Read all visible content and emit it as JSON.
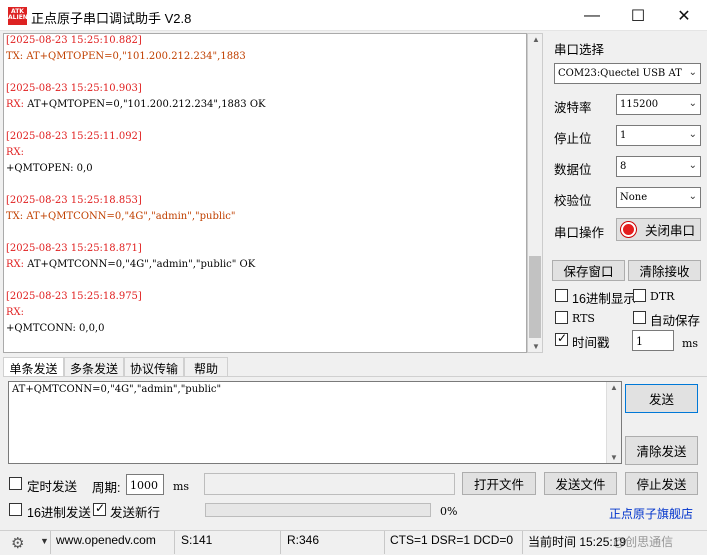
{
  "window": {
    "logo_text": "ATK ALIENTEK",
    "title": "正点原子串口调试助手 V2.8",
    "minimize": "—",
    "maximize": "☐",
    "close": "✕"
  },
  "receive": {
    "lines": [
      {
        "text": "[2025-08-23 15:25:10.882]",
        "color": "red"
      },
      {
        "text": "TX: AT+QMTOPEN=0,\"101.200.212.234\",1883",
        "color": "ora"
      },
      {
        "text": "",
        "color": "blk"
      },
      {
        "text": "[2025-08-23 15:25:10.903]",
        "color": "red"
      },
      {
        "text": "RX: AT+QMTOPEN=0,\"101.200.212.234\",1883 OK",
        "color": "blk",
        "prefix": "RX:",
        "rest": " AT+QMTOPEN=0,\"101.200.212.234\",1883 OK"
      },
      {
        "text": "",
        "color": "blk"
      },
      {
        "text": "[2025-08-23 15:25:11.092]",
        "color": "red"
      },
      {
        "text": "RX:",
        "color": "red"
      },
      {
        "text": "+QMTOPEN: 0,0",
        "color": "blk"
      },
      {
        "text": "",
        "color": "blk"
      },
      {
        "text": "[2025-08-23 15:25:18.853]",
        "color": "red"
      },
      {
        "text": "TX: AT+QMTCONN=0,\"4G\",\"admin\",\"public\"",
        "color": "ora"
      },
      {
        "text": "",
        "color": "blk"
      },
      {
        "text": "[2025-08-23 15:25:18.871]",
        "color": "red"
      },
      {
        "text": "RX: AT+QMTCONN=0,\"4G\",\"admin\",\"public\" OK",
        "color": "blk"
      },
      {
        "text": "",
        "color": "blk"
      },
      {
        "text": "[2025-08-23 15:25:18.975]",
        "color": "red"
      },
      {
        "text": "RX:",
        "color": "red"
      },
      {
        "text": "+QMTCONN: 0,0,0",
        "color": "blk"
      }
    ]
  },
  "serial": {
    "port_select_label": "串口选择",
    "port_value": "COM23:Quectel USB AT",
    "baud_label": "波特率",
    "baud_value": "115200",
    "stopbits_label": "停止位",
    "stopbits_value": "1",
    "databits_label": "数据位",
    "databits_value": "8",
    "parity_label": "校验位",
    "parity_value": "None",
    "op_label": "串口操作",
    "close_port_button": "关闭串口",
    "save_window_button": "保存窗口",
    "clear_receive_button": "清除接收",
    "hex_display_label": "16进制显示",
    "hex_display_checked": false,
    "dtr_label": "DTR",
    "dtr_checked": false,
    "rts_label": "RTS",
    "rts_checked": false,
    "auto_save_label": "自动保存",
    "auto_save_checked": false,
    "timestamp_label": "时间戳",
    "timestamp_checked": true,
    "timestamp_value": "1",
    "timestamp_unit": "ms"
  },
  "send": {
    "tabs": [
      "单条发送",
      "多条发送",
      "协议传输",
      "帮助"
    ],
    "active_tab": 0,
    "text": "AT+QMTCONN=0,\"4G\",\"admin\",\"public\"",
    "send_button": "发送",
    "clear_send_button": "清除发送",
    "timed_send_label": "定时发送",
    "timed_send_checked": false,
    "period_label": "周期:",
    "period_value": "1000",
    "period_unit": "ms",
    "file_path_value": "",
    "open_file_button": "打开文件",
    "send_file_button": "发送文件",
    "stop_send_button": "停止发送",
    "hex_send_label": "16进制发送",
    "hex_send_checked": false,
    "send_newline_label": "发送新行",
    "send_newline_checked": true,
    "progress": 0,
    "progress_text": "0%",
    "brand_link": "正点原子旗舰店"
  },
  "status": {
    "url": "www.openedv.com",
    "sent": "S:141",
    "received": "R:346",
    "signals": "CTS=1 DSR=1 DCD=0",
    "time": "当前时间 15:25:19",
    "watermark": "@创思通信"
  }
}
